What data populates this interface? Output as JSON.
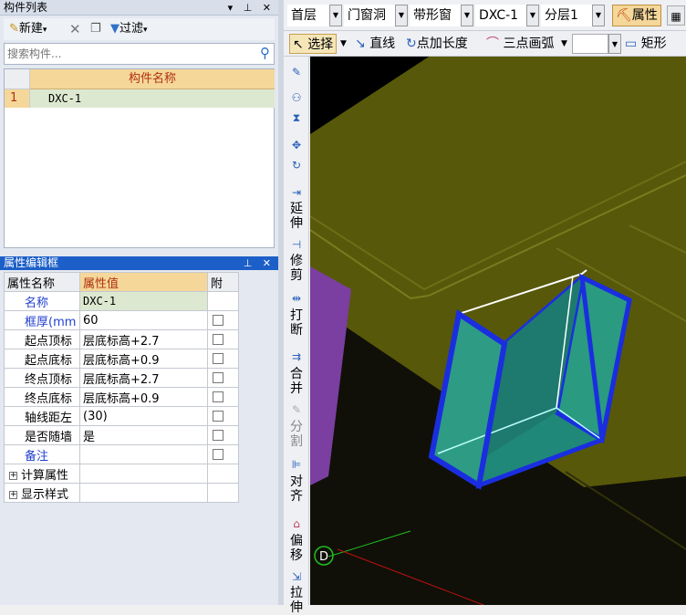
{
  "component_list": {
    "title": "构件列表",
    "title_buttons": "▾ ⊥ ✕",
    "new_label": "新建",
    "filter_label": "过滤",
    "search_placeholder": "搜索构件...",
    "column_header": "构件名称",
    "rows": [
      {
        "index": "1",
        "name": "DXC-1"
      }
    ]
  },
  "property_editor": {
    "title": "属性编辑框",
    "title_buttons": "⊥ ✕",
    "headers": {
      "name": "属性名称",
      "value": "属性值",
      "attach": "附"
    },
    "rows": [
      {
        "name": "名称",
        "value": "DXC-1"
      },
      {
        "name": "框厚(mm",
        "value": "60"
      },
      {
        "name": "起点顶标",
        "value": "层底标高+2.7"
      },
      {
        "name": "起点底标",
        "value": "层底标高+0.9"
      },
      {
        "name": "终点顶标",
        "value": "层底标高+2.7"
      },
      {
        "name": "终点底标",
        "value": "层底标高+0.9"
      },
      {
        "name": "轴线距左",
        "value": "(30)"
      },
      {
        "name": "是否随墙",
        "value": "是"
      },
      {
        "name": "备注",
        "value": ""
      }
    ],
    "groups": [
      "计算属性",
      "显示样式"
    ]
  },
  "toolbar1": {
    "floor": "首层",
    "category": "门窗洞",
    "type": "带形窗",
    "component": "DXC-1",
    "layer": "分层1",
    "property_label": "属性"
  },
  "toolbar2": {
    "select": "选择",
    "line": "直线",
    "point_length": "点加长度",
    "arc": "三点画弧",
    "rect": "矩形"
  },
  "vertical_tools": {
    "extend": [
      "延",
      "伸"
    ],
    "trim": [
      "修",
      "剪"
    ],
    "break": [
      "打",
      "断"
    ],
    "merge": [
      "合",
      "并"
    ],
    "split": [
      "分",
      "割"
    ],
    "align": [
      "对",
      "齐"
    ],
    "offset": [
      "偏",
      "移"
    ],
    "stretch": [
      "拉",
      "伸"
    ]
  },
  "canvas": {
    "axis_label": "D"
  },
  "colors": {
    "title_active": "#1c5fc8",
    "header_bg": "#f5d79a",
    "header_text": "#b03010",
    "window_frame": "#1a2ee0",
    "window_glass": "#2e9c84",
    "floor": "#5a5a00"
  }
}
